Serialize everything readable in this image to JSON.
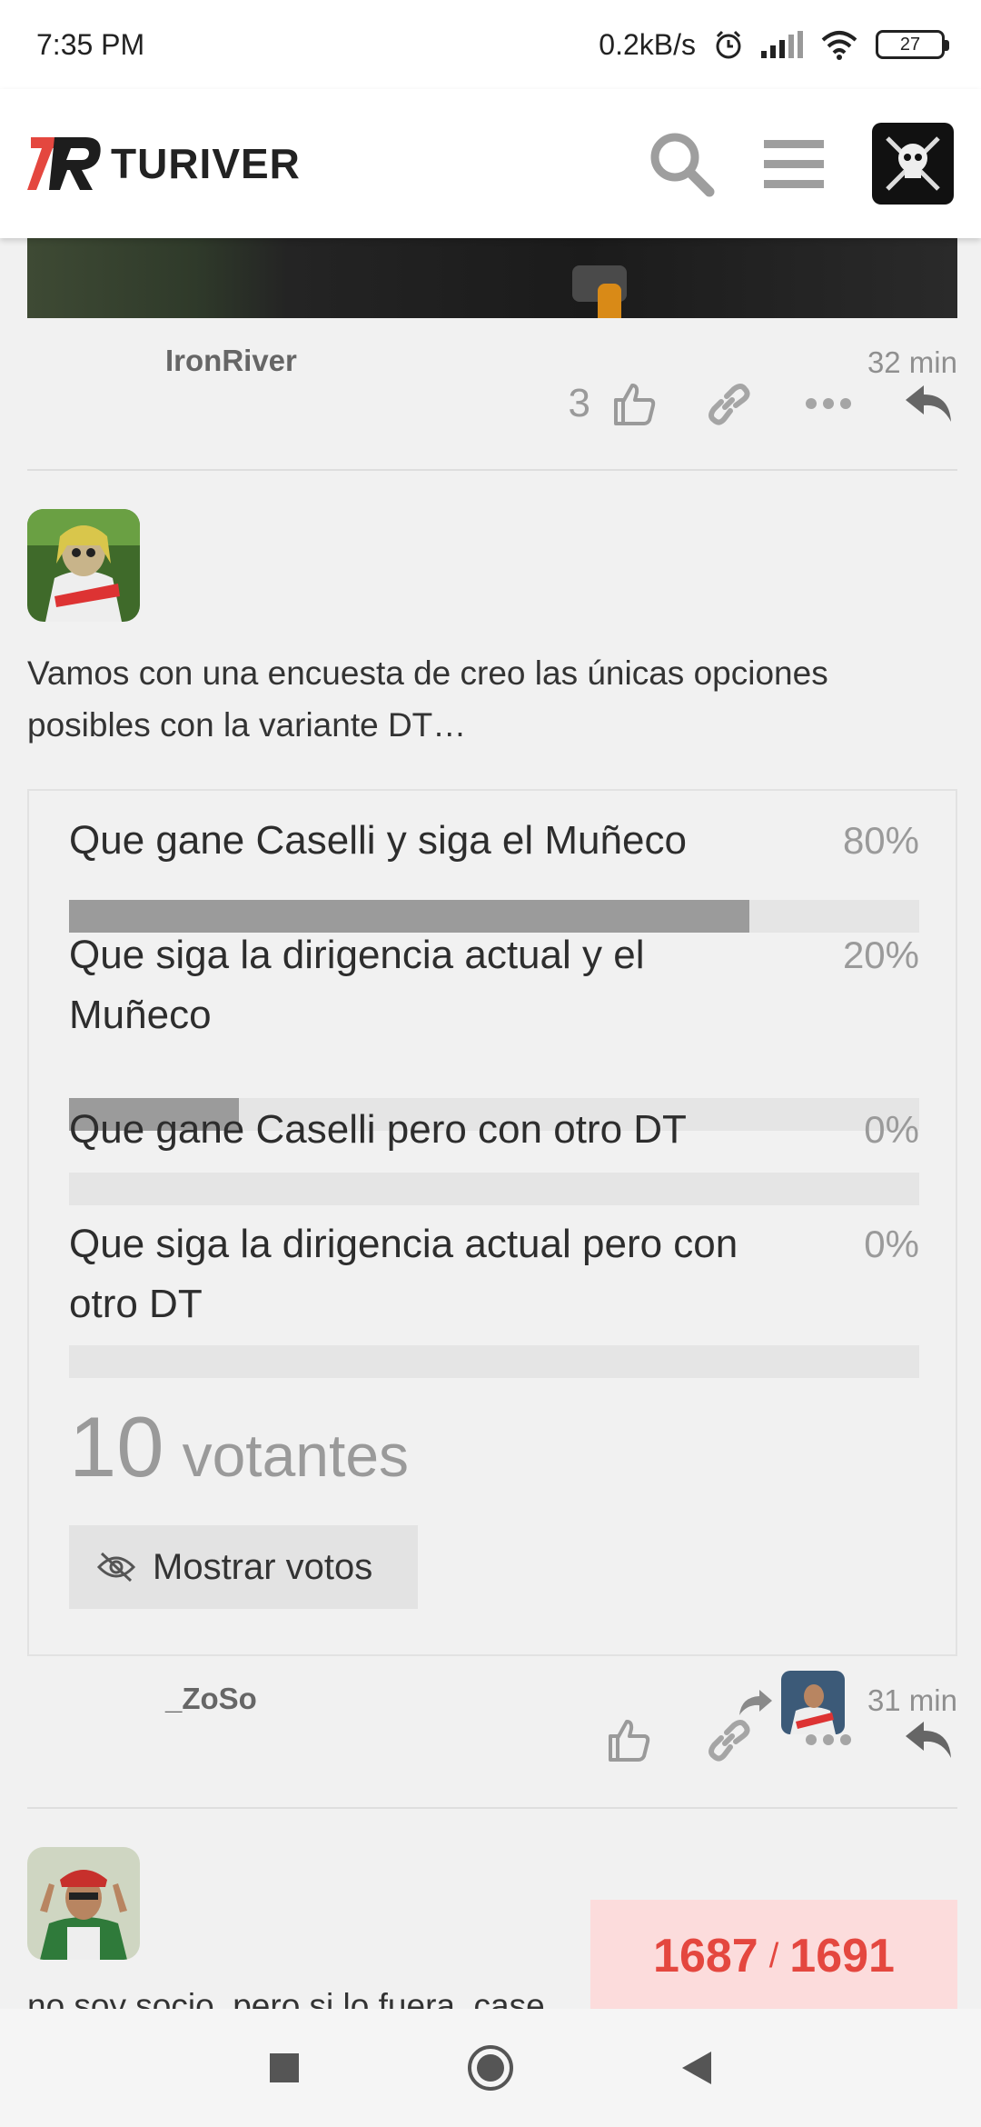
{
  "status_bar": {
    "time": "7:35 PM",
    "net_speed": "0.2kB/s",
    "battery": "27"
  },
  "header": {
    "logo_text": "TURIVER",
    "icons": [
      "search-icon",
      "hamburger-menu-icon",
      "user-avatar"
    ]
  },
  "prev_post": {
    "like_count": "3"
  },
  "post": {
    "username": "IronRiver",
    "time": "32 min",
    "text": "Vamos con una encuesta de creo las únicas opciones posibles con la variante DT…",
    "poll": {
      "options": [
        {
          "label": "Que gane Caselli y siga el Muñeco",
          "percent_label": "80%",
          "percent": 80
        },
        {
          "label": "Que siga la dirigencia actual y el Muñeco",
          "percent_label": "20%",
          "percent": 20
        },
        {
          "label": "Que gane Caselli pero con otro DT",
          "percent_label": "0%",
          "percent": 0
        },
        {
          "label": "Que siga la dirigencia actual pero con otro DT",
          "percent_label": "0%",
          "percent": 0
        }
      ],
      "voters_count": "10",
      "voters_label": "votantes",
      "show_votes_label": "Mostrar votos"
    }
  },
  "next_post": {
    "username": "_ZoSo",
    "time": "31 min",
    "text_partial": "no soy socio, pero si lo fuera, case"
  },
  "progress": {
    "current": "1687",
    "separator": "/",
    "total": "1691"
  },
  "colors": {
    "brand_red": "#e4473f",
    "progress_bg": "#fcdcdc",
    "bar_fill": "#9b9b9b",
    "bar_track": "#e5e5e5"
  }
}
